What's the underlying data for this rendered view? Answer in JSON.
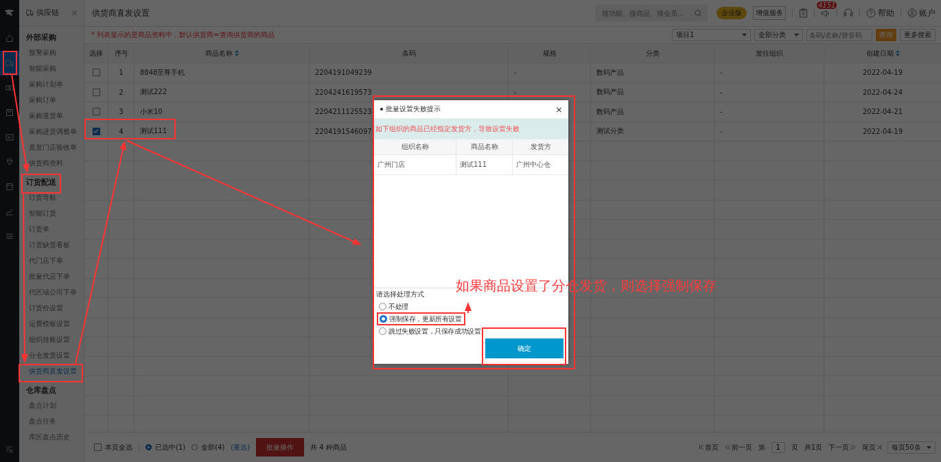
{
  "app": {
    "module": "供应链",
    "close": "×",
    "page_title": "供货商直发设置"
  },
  "header": {
    "search_placeholder": "搜功能、搜商品、搜会员...",
    "edition": "企业版",
    "value_added": "增值服务",
    "notification_count": "4151",
    "help": "帮助",
    "account": "账户"
  },
  "rail": [
    {
      "selected": false
    },
    {
      "selected": true
    },
    {
      "selected": false
    },
    {
      "selected": false
    },
    {
      "selected": false
    },
    {
      "selected": false
    },
    {
      "selected": false
    },
    {
      "selected": false
    },
    {
      "selected": false
    }
  ],
  "sidebar": {
    "groups": [
      {
        "title": "外部采购",
        "items": [
          {
            "label": "预警采购",
            "selected": false
          },
          {
            "label": "智能采购",
            "selected": false
          },
          {
            "label": "采购计划单",
            "selected": false
          },
          {
            "label": "采购订单",
            "selected": false
          },
          {
            "label": "采购退货单",
            "selected": false
          },
          {
            "label": "采购进货调整单",
            "selected": false
          },
          {
            "label": "直发门店验收单",
            "selected": false
          },
          {
            "label": "供货商资料",
            "selected": false
          }
        ]
      },
      {
        "title": "订货配送",
        "items": [
          {
            "label": "订货导航",
            "selected": false
          },
          {
            "label": "智能订货",
            "selected": false
          },
          {
            "label": "订货单",
            "selected": false
          },
          {
            "label": "订货缺货看板",
            "selected": false
          },
          {
            "label": "代门店下单",
            "selected": false
          },
          {
            "label": "批量代店下单",
            "selected": false
          },
          {
            "label": "代区域公司下单",
            "selected": false
          },
          {
            "label": "订货价设置",
            "selected": false
          },
          {
            "label": "运费模板设置",
            "selected": false
          },
          {
            "label": "组织挂账设置",
            "selected": false
          },
          {
            "label": "分仓发货设置",
            "selected": false
          },
          {
            "label": "供货商直发设置",
            "selected": true
          }
        ]
      },
      {
        "title": "仓库盘点",
        "items": [
          {
            "label": "盘点计划",
            "selected": false
          },
          {
            "label": "盘点任务",
            "selected": false
          },
          {
            "label": "库区盘点历史",
            "selected": false
          }
        ]
      }
    ]
  },
  "notice": "* 列表显示的是商品资料中，默认供货商=查询供货商的商品",
  "filters": {
    "project": "项目1",
    "category": "全部分类",
    "search_placeholder": "条码/名称/拼音码",
    "query": "查询",
    "more": "更多搜索"
  },
  "table": {
    "select_column": "选择",
    "columns": [
      {
        "label": "序号",
        "sortable": false
      },
      {
        "label": "商品名称",
        "sortable": true
      },
      {
        "label": "条码",
        "sortable": false
      },
      {
        "label": "规格",
        "sortable": false
      },
      {
        "label": "分类",
        "sortable": false
      },
      {
        "label": "发往组织",
        "sortable": false
      },
      {
        "label": "创建日期",
        "sortable": true
      }
    ],
    "rows": [
      {
        "checked": false,
        "cells": [
          "1",
          "8848至尊手机",
          "2204191049239",
          "-",
          "数码产品",
          "-",
          "2022-04-19"
        ]
      },
      {
        "checked": false,
        "cells": [
          "2",
          "测试222",
          "2204241619573",
          "-",
          "数码产品",
          "-",
          "2022-04-24"
        ]
      },
      {
        "checked": false,
        "cells": [
          "3",
          "小米10",
          "2204211125523",
          null,
          "数码产品",
          "-",
          "2022-04-21"
        ]
      },
      {
        "checked": true,
        "cells": [
          "4",
          "测试111",
          "2204191546097",
          null,
          "测试分类",
          "-",
          "2022-04-19"
        ]
      }
    ]
  },
  "footer": {
    "select_page": {
      "label": "本页全选",
      "checked": false
    },
    "scope": [
      {
        "label": "已选中(1)",
        "selected": true
      },
      {
        "label": "全部(4)",
        "selected": false
      }
    ],
    "reselect": "(重选)",
    "batch": "批量操作",
    "total": "共 4 种商品",
    "pager": {
      "first": "首页",
      "prev": "前一页",
      "page_prefix": "第",
      "page": "1",
      "page_suffix": "页",
      "pages": "共1页",
      "next": "下一页",
      "last": "尾页",
      "per_page": "每页50条"
    }
  },
  "dialog": {
    "title": "批量设置失败提示",
    "close": "×",
    "message": "如下组织的商品已经指定发货方，导致设置失败",
    "columns": [
      "组织名称",
      "商品名称",
      "发货方"
    ],
    "rows": [
      [
        "广州门店",
        "测试111",
        "广州中心仓"
      ]
    ],
    "prompt": "请选择处理方式",
    "options": [
      {
        "label": "不处理",
        "selected": false
      },
      {
        "label": "强制保存，更新所有设置",
        "selected": true
      },
      {
        "label": "跳过失败设置，只保存成功设置",
        "selected": false
      }
    ],
    "confirm": "确定"
  },
  "annotation": {
    "callout": "如果商品设置了分仓发货，则选择强制保存"
  }
}
